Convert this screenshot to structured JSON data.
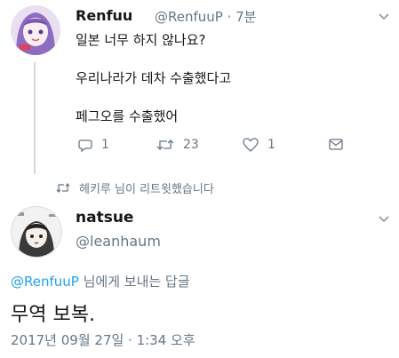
{
  "tweet1": {
    "display_name": "Renfuu",
    "meta": "@RenfuuP · 7분",
    "lines": [
      "일본 너무 하지 않나요?",
      "우리나라가 데차 수출했다고",
      "페그오를 수출했어"
    ],
    "actions": {
      "reply": "1",
      "retweet": "23",
      "like": "1"
    }
  },
  "retweet_notice": "헤키루 님이 리트윗했습니다",
  "tweet2": {
    "display_name": "natsue",
    "handle": "@leanhaum",
    "reply_mention": "@RenfuuP",
    "reply_suffix": " 님에게 보내는 답글",
    "text": "무역 보복.",
    "timestamp": "2017년 09월 27일 · 1:34 오후"
  },
  "colors": {
    "secondary_text": "#657786",
    "link_blue": "#1da1f2",
    "thread_line": "#cfd9de"
  }
}
